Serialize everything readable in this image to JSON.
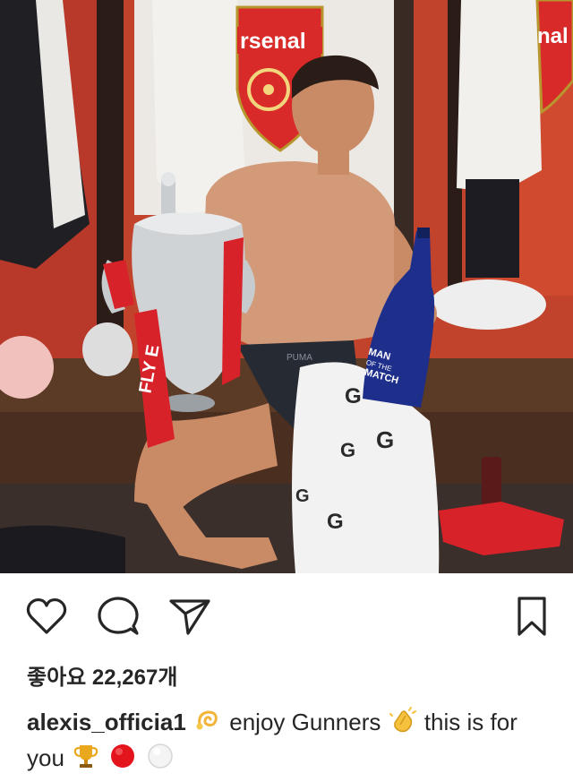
{
  "post": {
    "likes_text": "좋아요 22,267개",
    "username": "alexis_officia1",
    "caption_part1": "enjoy Gunners",
    "caption_part2": "this is for you",
    "emojis": [
      "dizzy-emoji",
      "clapping-hands-emoji",
      "trophy-emoji",
      "red-circle-emoji",
      "white-circle-emoji"
    ]
  },
  "photo": {
    "banner_left_text": "rsenal",
    "banner_right_text": "nal",
    "bottle_text_line1": "MAN",
    "bottle_text_line2": "OF THE",
    "bottle_text_line3": "MATCH",
    "shorts_brand_text": "PUMA",
    "ribbon_text": "FLY E",
    "colors": {
      "wall_red": "#c2432b",
      "crest_red": "#d92a2a",
      "bottle_blue": "#1d2f8a",
      "trophy_silver": "#cfd3d6",
      "bench_wood": "#5b3a26"
    }
  },
  "actions": {
    "like_icon": "heart-icon",
    "comment_icon": "comment-icon",
    "share_icon": "share-icon",
    "save_icon": "bookmark-icon"
  }
}
